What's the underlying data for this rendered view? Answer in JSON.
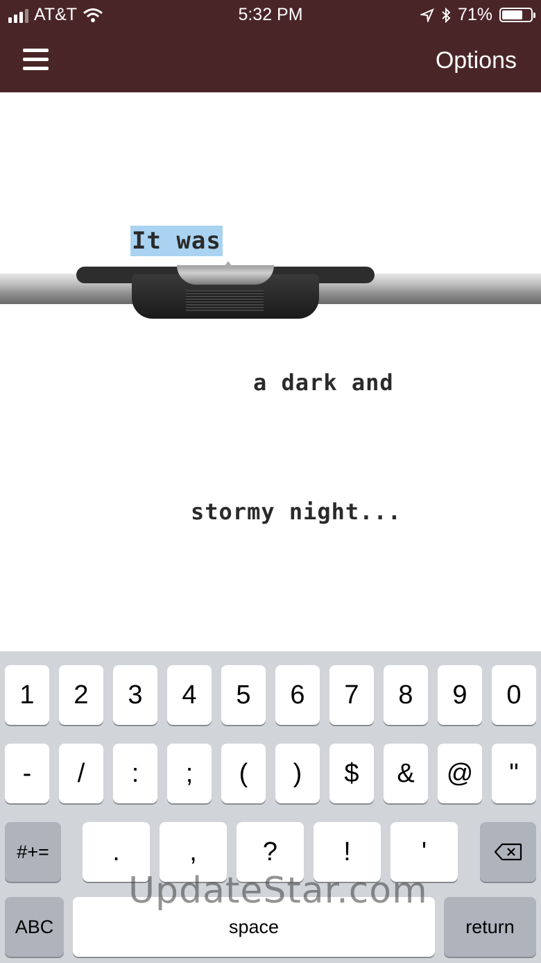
{
  "status_bar": {
    "carrier": "AT&T",
    "time": "5:32 PM",
    "battery": "71%"
  },
  "header": {
    "options_label": "Options",
    "icons": [
      "menu-icon",
      "wifi-icon",
      "location-icon",
      "bluetooth-icon",
      "battery-icon"
    ]
  },
  "document": {
    "line1": "It was",
    "line2": "a dark and",
    "line3": "stormy night..."
  },
  "keyboard": {
    "row1": [
      "1",
      "2",
      "3",
      "4",
      "5",
      "6",
      "7",
      "8",
      "9",
      "0"
    ],
    "row2": [
      "-",
      "/",
      ":",
      ";",
      "(",
      ")",
      "$",
      "&",
      "@",
      "\""
    ],
    "row3": [
      ".",
      ",",
      "?",
      "!",
      "'"
    ],
    "symbols_label": "#+=",
    "abc_label": "ABC",
    "space_label": "space",
    "return_label": "return"
  },
  "watermark": "UpdateStar.com"
}
